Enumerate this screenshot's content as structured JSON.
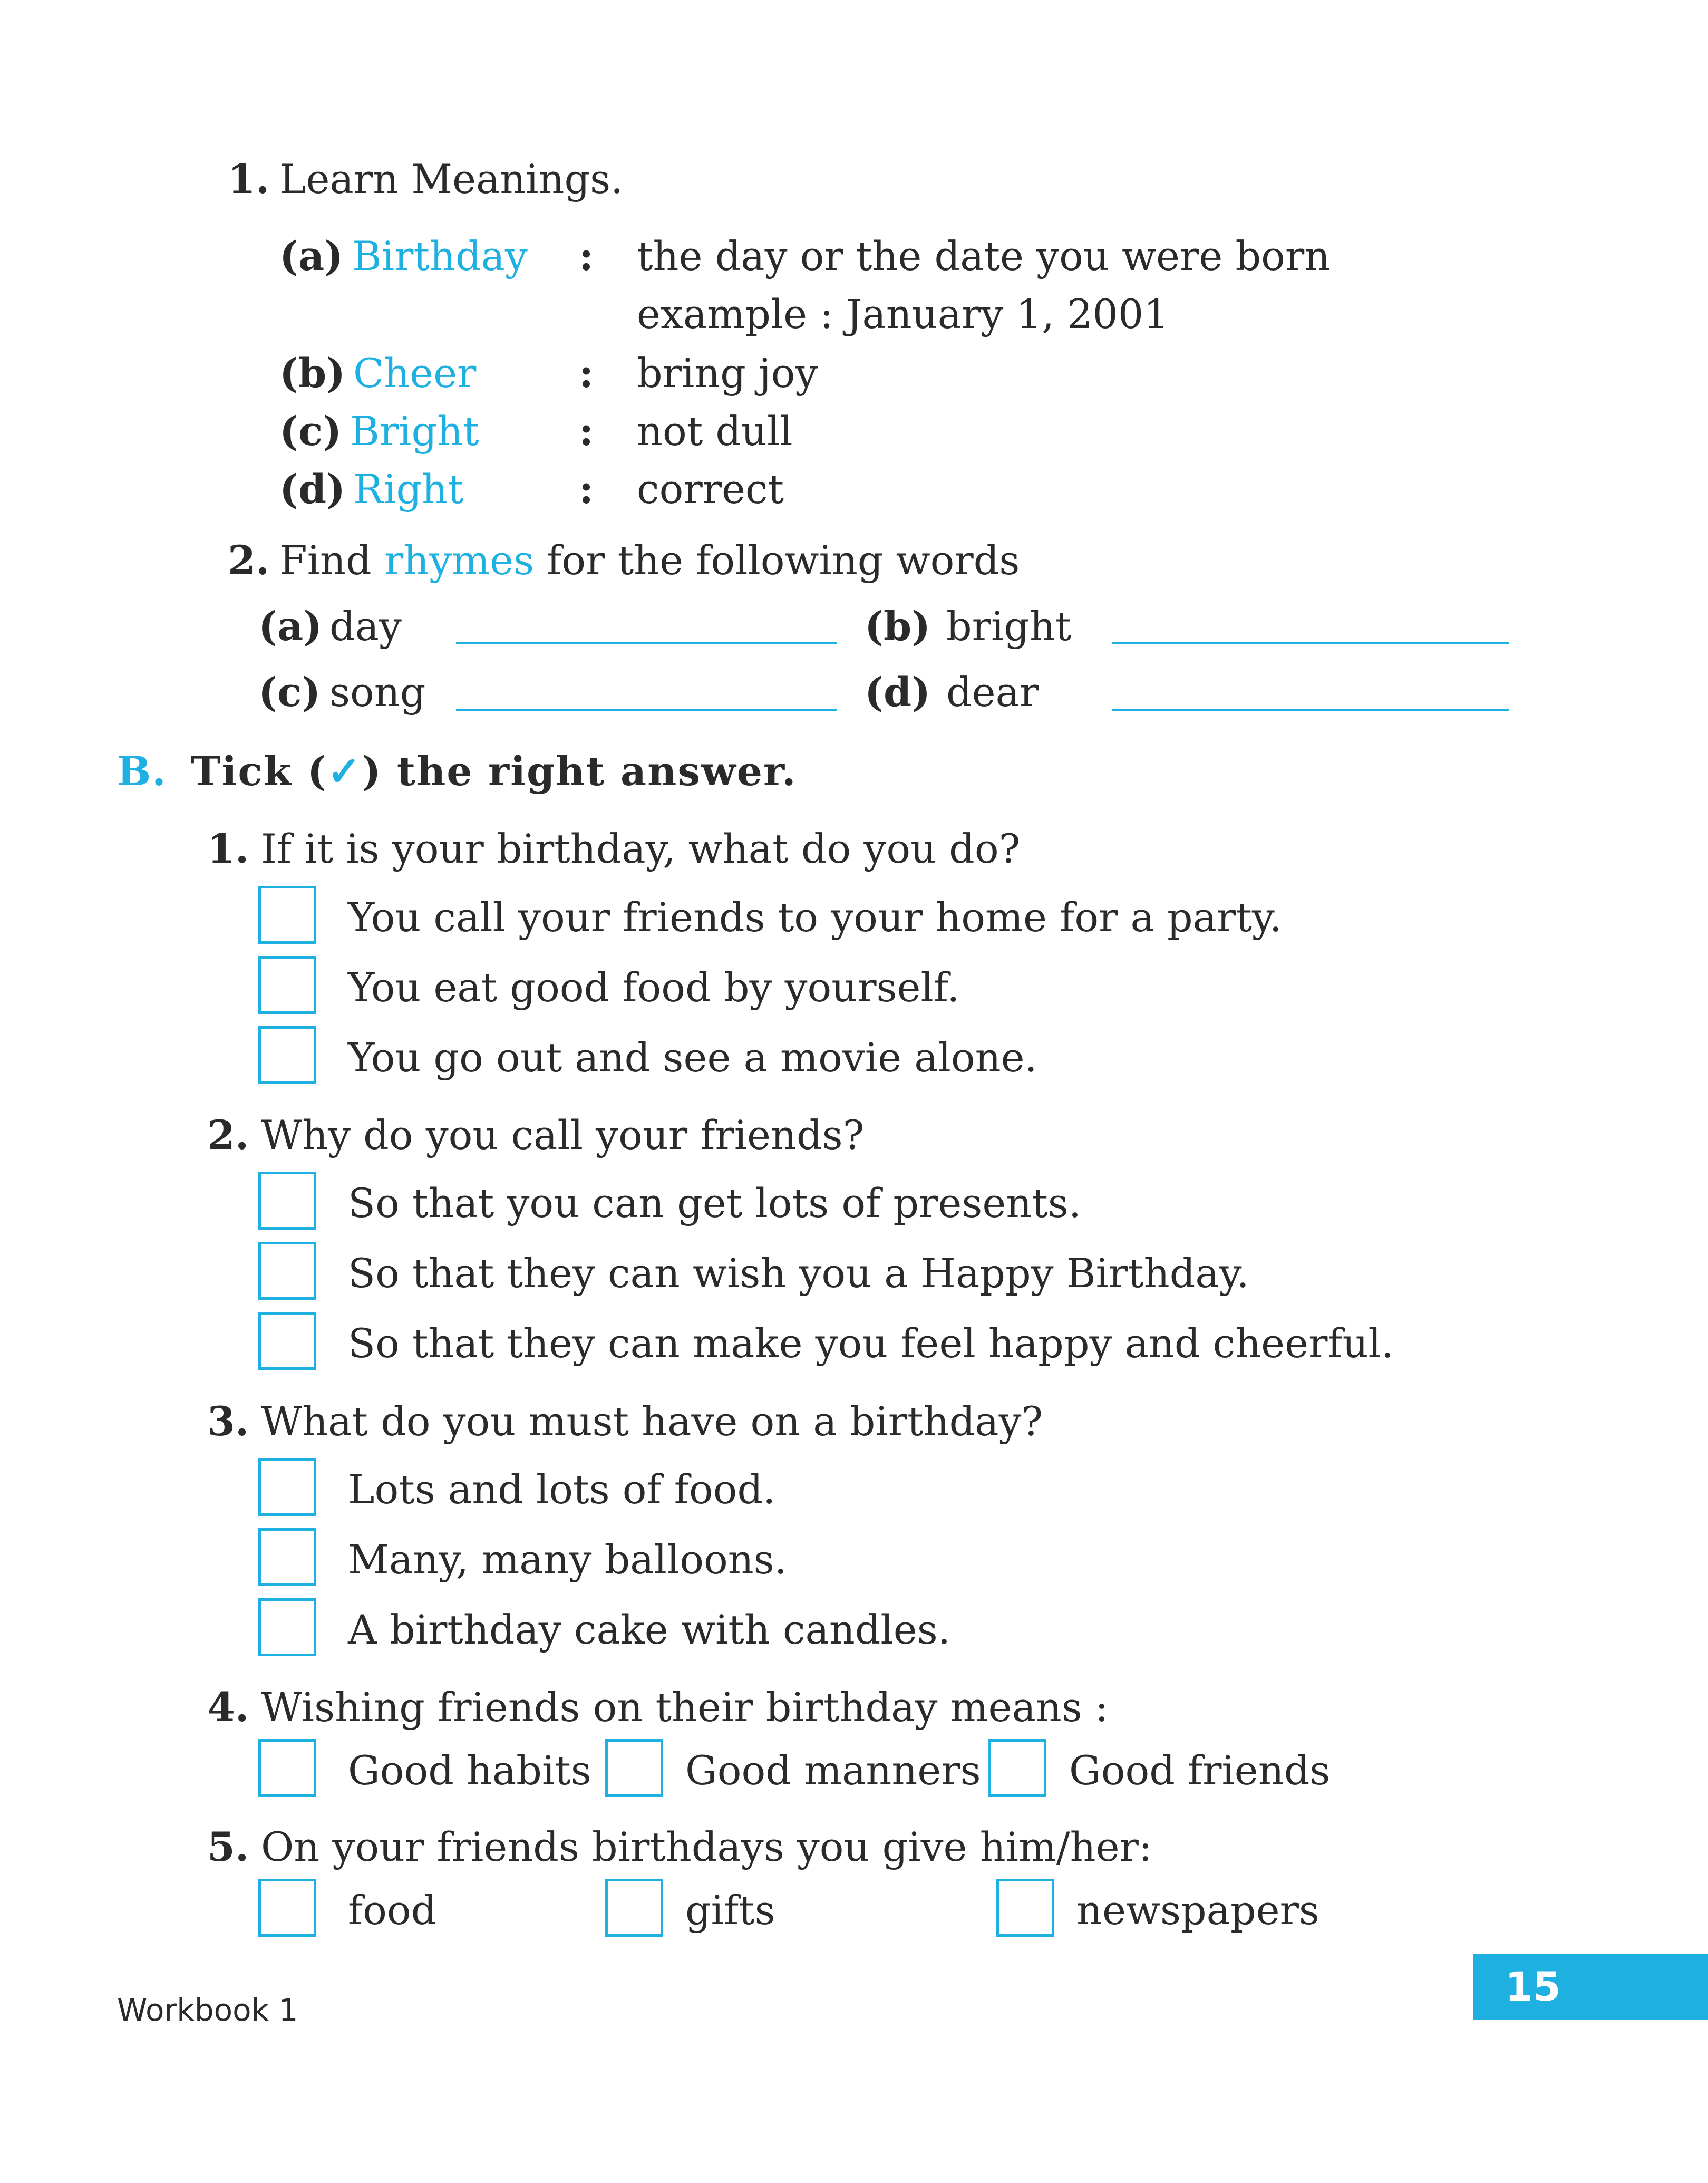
{
  "section_a": {
    "q1": {
      "number": "1.",
      "text": "Learn Meanings.",
      "items": [
        {
          "label": "(a)",
          "word": "Birthday",
          "colon": ":",
          "meaning": "the day or the date you were born"
        },
        {
          "label": "(b)",
          "word": "Cheer",
          "colon": ":",
          "meaning": "bring joy"
        },
        {
          "label": "(c)",
          "word": "Bright",
          "colon": ":",
          "meaning": "not dull"
        },
        {
          "label": "(d)",
          "word": "Right",
          "colon": ":",
          "meaning": "correct"
        }
      ],
      "example": "example : January 1, 2001"
    },
    "q2": {
      "number": "2.",
      "text_before": "Find",
      "highlight": "rhymes",
      "text_after": "for the following words",
      "items": [
        {
          "label": "(a)",
          "word": "day"
        },
        {
          "label": "(b)",
          "word": "bright"
        },
        {
          "label": "(c)",
          "word": "song"
        },
        {
          "label": "(d)",
          "word": "dear"
        }
      ]
    }
  },
  "section_b": {
    "letter": "B.",
    "title_before": "Tick (",
    "tick": "✓",
    "title_after": ") the right answer.",
    "questions": [
      {
        "number": "1.",
        "text": "If it is your birthday, what do you do?",
        "options": [
          "You call your friends to your home for a party.",
          "You eat good food by yourself.",
          "You go out and see a movie alone."
        ]
      },
      {
        "number": "2.",
        "text": "Why do you call your friends?",
        "options": [
          "So that you can get lots of presents.",
          "So that they can wish you a Happy Birthday.",
          "So that they can make you feel happy and cheerful."
        ]
      },
      {
        "number": "3.",
        "text": "What do you must have on a birthday?",
        "options": [
          "Lots and lots of food.",
          "Many, many balloons.",
          "A birthday cake with candles."
        ]
      },
      {
        "number": "4.",
        "text": "Wishing friends on their birthday means :",
        "options": [
          "Good habits",
          "Good manners",
          "Good friends"
        ]
      },
      {
        "number": "5.",
        "text": "On your friends birthdays you give him/her:",
        "options": [
          "food",
          "gifts",
          "newspapers"
        ]
      }
    ]
  },
  "footer": {
    "label": "Workbook 1",
    "page": "15"
  },
  "colors": {
    "accent": "#1eb0e0",
    "text": "#2a2a2a"
  }
}
